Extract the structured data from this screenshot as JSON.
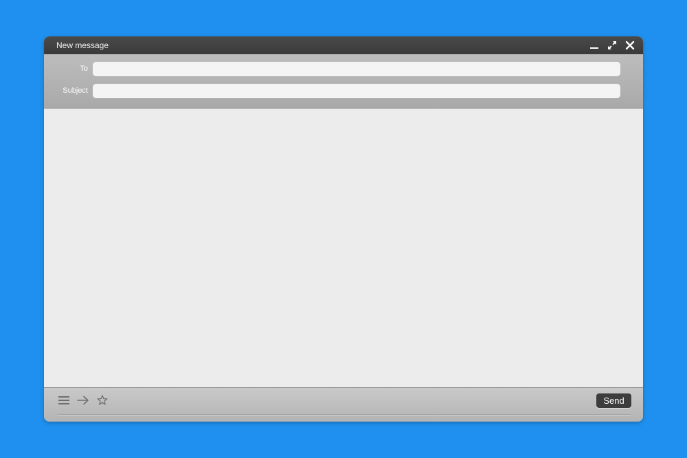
{
  "colors": {
    "background": "#1f90f0",
    "titlebar": "#3f3f3f",
    "header": "#b3b3b3",
    "body": "#ececec",
    "send_button": "#3d3d3d"
  },
  "window": {
    "title": "New message",
    "controls": [
      "minimize-icon",
      "expand-icon",
      "close-icon"
    ]
  },
  "fields": {
    "to_label": "To",
    "to_value": "",
    "subject_label": "Subject",
    "subject_value": ""
  },
  "message": {
    "body": ""
  },
  "footer": {
    "icons": [
      "menu-icon",
      "arrow-right-icon",
      "star-icon"
    ],
    "send_label": "Send"
  }
}
